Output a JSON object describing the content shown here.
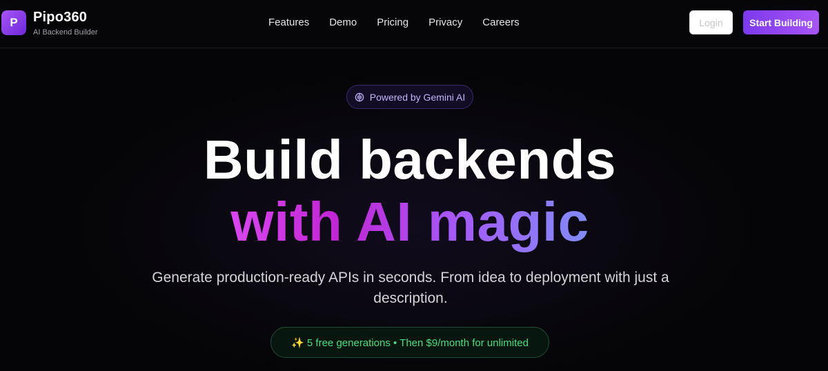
{
  "header": {
    "logo_letter": "P",
    "brand_name": "Pipo360",
    "brand_tagline": "AI Backend Builder",
    "nav": [
      {
        "label": "Features"
      },
      {
        "label": "Demo"
      },
      {
        "label": "Pricing"
      },
      {
        "label": "Privacy"
      },
      {
        "label": "Careers"
      }
    ],
    "login_label": "Login",
    "start_label": "Start Building"
  },
  "hero": {
    "badge_icon": "brain-icon",
    "badge_label": "Powered by Gemini AI",
    "headline_line1": "Build backends",
    "headline_line2": "with AI magic",
    "subtitle": "Generate production-ready APIs in seconds. From idea to deployment with just a description.",
    "free_offer": "✨ 5 free generations • Then $9/month for unlimited"
  },
  "colors": {
    "background": "#050507",
    "accent_purple": "#7c3aed",
    "gradient_start": "#d946ef",
    "gradient_end": "#818cf8",
    "offer_green": "#4ade80"
  }
}
